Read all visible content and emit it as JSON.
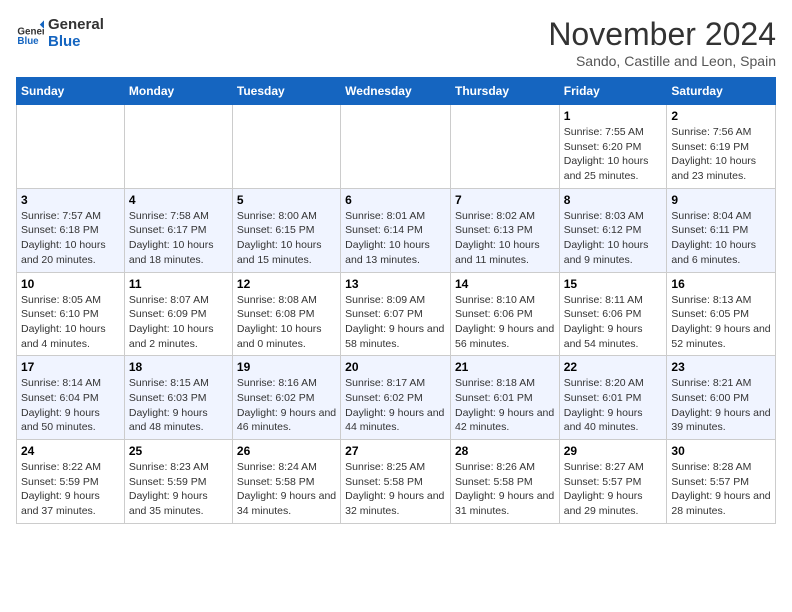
{
  "logo": {
    "line1": "General",
    "line2": "Blue"
  },
  "title": "November 2024",
  "location": "Sando, Castille and Leon, Spain",
  "weekdays": [
    "Sunday",
    "Monday",
    "Tuesday",
    "Wednesday",
    "Thursday",
    "Friday",
    "Saturday"
  ],
  "weeks": [
    [
      {
        "day": "",
        "info": ""
      },
      {
        "day": "",
        "info": ""
      },
      {
        "day": "",
        "info": ""
      },
      {
        "day": "",
        "info": ""
      },
      {
        "day": "",
        "info": ""
      },
      {
        "day": "1",
        "info": "Sunrise: 7:55 AM\nSunset: 6:20 PM\nDaylight: 10 hours and 25 minutes."
      },
      {
        "day": "2",
        "info": "Sunrise: 7:56 AM\nSunset: 6:19 PM\nDaylight: 10 hours and 23 minutes."
      }
    ],
    [
      {
        "day": "3",
        "info": "Sunrise: 7:57 AM\nSunset: 6:18 PM\nDaylight: 10 hours and 20 minutes."
      },
      {
        "day": "4",
        "info": "Sunrise: 7:58 AM\nSunset: 6:17 PM\nDaylight: 10 hours and 18 minutes."
      },
      {
        "day": "5",
        "info": "Sunrise: 8:00 AM\nSunset: 6:15 PM\nDaylight: 10 hours and 15 minutes."
      },
      {
        "day": "6",
        "info": "Sunrise: 8:01 AM\nSunset: 6:14 PM\nDaylight: 10 hours and 13 minutes."
      },
      {
        "day": "7",
        "info": "Sunrise: 8:02 AM\nSunset: 6:13 PM\nDaylight: 10 hours and 11 minutes."
      },
      {
        "day": "8",
        "info": "Sunrise: 8:03 AM\nSunset: 6:12 PM\nDaylight: 10 hours and 9 minutes."
      },
      {
        "day": "9",
        "info": "Sunrise: 8:04 AM\nSunset: 6:11 PM\nDaylight: 10 hours and 6 minutes."
      }
    ],
    [
      {
        "day": "10",
        "info": "Sunrise: 8:05 AM\nSunset: 6:10 PM\nDaylight: 10 hours and 4 minutes."
      },
      {
        "day": "11",
        "info": "Sunrise: 8:07 AM\nSunset: 6:09 PM\nDaylight: 10 hours and 2 minutes."
      },
      {
        "day": "12",
        "info": "Sunrise: 8:08 AM\nSunset: 6:08 PM\nDaylight: 10 hours and 0 minutes."
      },
      {
        "day": "13",
        "info": "Sunrise: 8:09 AM\nSunset: 6:07 PM\nDaylight: 9 hours and 58 minutes."
      },
      {
        "day": "14",
        "info": "Sunrise: 8:10 AM\nSunset: 6:06 PM\nDaylight: 9 hours and 56 minutes."
      },
      {
        "day": "15",
        "info": "Sunrise: 8:11 AM\nSunset: 6:06 PM\nDaylight: 9 hours and 54 minutes."
      },
      {
        "day": "16",
        "info": "Sunrise: 8:13 AM\nSunset: 6:05 PM\nDaylight: 9 hours and 52 minutes."
      }
    ],
    [
      {
        "day": "17",
        "info": "Sunrise: 8:14 AM\nSunset: 6:04 PM\nDaylight: 9 hours and 50 minutes."
      },
      {
        "day": "18",
        "info": "Sunrise: 8:15 AM\nSunset: 6:03 PM\nDaylight: 9 hours and 48 minutes."
      },
      {
        "day": "19",
        "info": "Sunrise: 8:16 AM\nSunset: 6:02 PM\nDaylight: 9 hours and 46 minutes."
      },
      {
        "day": "20",
        "info": "Sunrise: 8:17 AM\nSunset: 6:02 PM\nDaylight: 9 hours and 44 minutes."
      },
      {
        "day": "21",
        "info": "Sunrise: 8:18 AM\nSunset: 6:01 PM\nDaylight: 9 hours and 42 minutes."
      },
      {
        "day": "22",
        "info": "Sunrise: 8:20 AM\nSunset: 6:01 PM\nDaylight: 9 hours and 40 minutes."
      },
      {
        "day": "23",
        "info": "Sunrise: 8:21 AM\nSunset: 6:00 PM\nDaylight: 9 hours and 39 minutes."
      }
    ],
    [
      {
        "day": "24",
        "info": "Sunrise: 8:22 AM\nSunset: 5:59 PM\nDaylight: 9 hours and 37 minutes."
      },
      {
        "day": "25",
        "info": "Sunrise: 8:23 AM\nSunset: 5:59 PM\nDaylight: 9 hours and 35 minutes."
      },
      {
        "day": "26",
        "info": "Sunrise: 8:24 AM\nSunset: 5:58 PM\nDaylight: 9 hours and 34 minutes."
      },
      {
        "day": "27",
        "info": "Sunrise: 8:25 AM\nSunset: 5:58 PM\nDaylight: 9 hours and 32 minutes."
      },
      {
        "day": "28",
        "info": "Sunrise: 8:26 AM\nSunset: 5:58 PM\nDaylight: 9 hours and 31 minutes."
      },
      {
        "day": "29",
        "info": "Sunrise: 8:27 AM\nSunset: 5:57 PM\nDaylight: 9 hours and 29 minutes."
      },
      {
        "day": "30",
        "info": "Sunrise: 8:28 AM\nSunset: 5:57 PM\nDaylight: 9 hours and 28 minutes."
      }
    ]
  ]
}
